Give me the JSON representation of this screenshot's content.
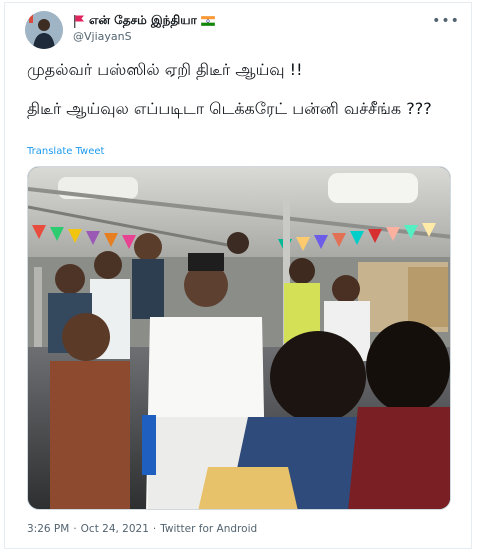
{
  "author": {
    "display_name": "என் தேசம் இந்தியா",
    "handle": "@VjiayanS",
    "avatar_icon": "profile-photo",
    "leading_icon": "red-flag-icon",
    "trailing_icon": "india-flag-icon"
  },
  "tweet": {
    "line1": "முதல்வர் பஸ்ஸில் ஏறி திடீர் ஆய்வு !!",
    "line2": "திடீர் ஆய்வுல எப்படிடா டெக்கரேட் பன்னி வச்சீங்க ???",
    "translate_label": "Translate Tweet"
  },
  "media": {
    "kind": "photo"
  },
  "meta": {
    "time": "3:26 PM",
    "separator1": "·",
    "date": "Oct 24, 2021",
    "separator2": "·",
    "source": "Twitter for Android"
  },
  "colors": {
    "link": "#1d9bf0",
    "secondary_text": "#536471",
    "primary_text": "#0f1419",
    "border": "#e6ecf0"
  }
}
